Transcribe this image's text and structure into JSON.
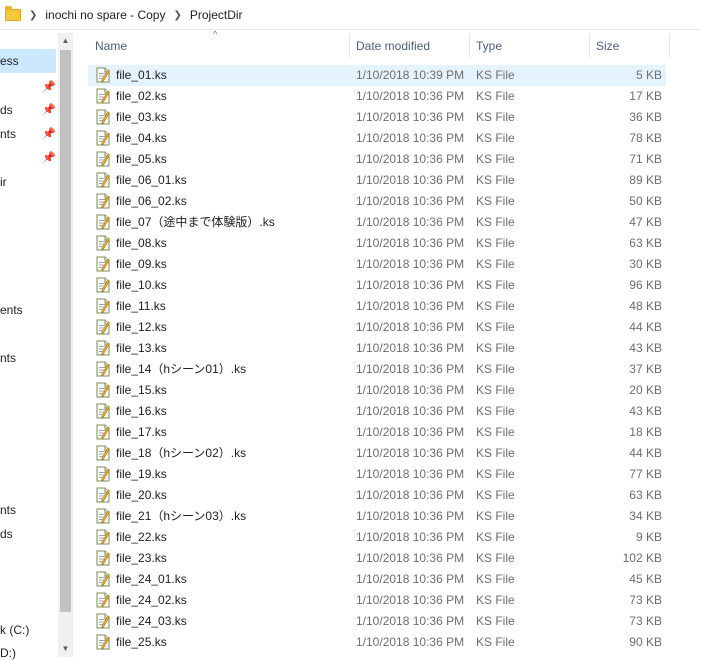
{
  "breadcrumb": {
    "items": [
      "inochi no spare - Copy",
      "ProjectDir"
    ]
  },
  "nav": {
    "items": [
      "ess",
      "ds",
      "nts",
      "",
      "ir",
      "ents",
      "nts",
      "nts",
      "ds",
      "k (C:)",
      "D:)"
    ]
  },
  "columns": {
    "name": "Name",
    "date": "Date modified",
    "type": "Type",
    "size": "Size"
  },
  "files": [
    {
      "name": "file_01.ks",
      "date": "1/10/2018 10:39 PM",
      "type": "KS File",
      "size": "5 KB"
    },
    {
      "name": "file_02.ks",
      "date": "1/10/2018 10:36 PM",
      "type": "KS File",
      "size": "17 KB"
    },
    {
      "name": "file_03.ks",
      "date": "1/10/2018 10:36 PM",
      "type": "KS File",
      "size": "36 KB"
    },
    {
      "name": "file_04.ks",
      "date": "1/10/2018 10:36 PM",
      "type": "KS File",
      "size": "78 KB"
    },
    {
      "name": "file_05.ks",
      "date": "1/10/2018 10:36 PM",
      "type": "KS File",
      "size": "71 KB"
    },
    {
      "name": "file_06_01.ks",
      "date": "1/10/2018 10:36 PM",
      "type": "KS File",
      "size": "89 KB"
    },
    {
      "name": "file_06_02.ks",
      "date": "1/10/2018 10:36 PM",
      "type": "KS File",
      "size": "50 KB"
    },
    {
      "name": "file_07（途中まで体験版）.ks",
      "date": "1/10/2018 10:36 PM",
      "type": "KS File",
      "size": "47 KB"
    },
    {
      "name": "file_08.ks",
      "date": "1/10/2018 10:36 PM",
      "type": "KS File",
      "size": "63 KB"
    },
    {
      "name": "file_09.ks",
      "date": "1/10/2018 10:36 PM",
      "type": "KS File",
      "size": "30 KB"
    },
    {
      "name": "file_10.ks",
      "date": "1/10/2018 10:36 PM",
      "type": "KS File",
      "size": "96 KB"
    },
    {
      "name": "file_11.ks",
      "date": "1/10/2018 10:36 PM",
      "type": "KS File",
      "size": "48 KB"
    },
    {
      "name": "file_12.ks",
      "date": "1/10/2018 10:36 PM",
      "type": "KS File",
      "size": "44 KB"
    },
    {
      "name": "file_13.ks",
      "date": "1/10/2018 10:36 PM",
      "type": "KS File",
      "size": "43 KB"
    },
    {
      "name": "file_14（hシーン01）.ks",
      "date": "1/10/2018 10:36 PM",
      "type": "KS File",
      "size": "37 KB"
    },
    {
      "name": "file_15.ks",
      "date": "1/10/2018 10:36 PM",
      "type": "KS File",
      "size": "20 KB"
    },
    {
      "name": "file_16.ks",
      "date": "1/10/2018 10:36 PM",
      "type": "KS File",
      "size": "43 KB"
    },
    {
      "name": "file_17.ks",
      "date": "1/10/2018 10:36 PM",
      "type": "KS File",
      "size": "18 KB"
    },
    {
      "name": "file_18（hシーン02）.ks",
      "date": "1/10/2018 10:36 PM",
      "type": "KS File",
      "size": "44 KB"
    },
    {
      "name": "file_19.ks",
      "date": "1/10/2018 10:36 PM",
      "type": "KS File",
      "size": "77 KB"
    },
    {
      "name": "file_20.ks",
      "date": "1/10/2018 10:36 PM",
      "type": "KS File",
      "size": "63 KB"
    },
    {
      "name": "file_21（hシーン03）.ks",
      "date": "1/10/2018 10:36 PM",
      "type": "KS File",
      "size": "34 KB"
    },
    {
      "name": "file_22.ks",
      "date": "1/10/2018 10:36 PM",
      "type": "KS File",
      "size": "9 KB"
    },
    {
      "name": "file_23.ks",
      "date": "1/10/2018 10:36 PM",
      "type": "KS File",
      "size": "102 KB"
    },
    {
      "name": "file_24_01.ks",
      "date": "1/10/2018 10:36 PM",
      "type": "KS File",
      "size": "45 KB"
    },
    {
      "name": "file_24_02.ks",
      "date": "1/10/2018 10:36 PM",
      "type": "KS File",
      "size": "73 KB"
    },
    {
      "name": "file_24_03.ks",
      "date": "1/10/2018 10:36 PM",
      "type": "KS File",
      "size": "73 KB"
    },
    {
      "name": "file_25.ks",
      "date": "1/10/2018 10:36 PM",
      "type": "KS File",
      "size": "90 KB"
    }
  ],
  "selected_index": 0,
  "icons": {
    "breadcrumb_folder": "folder-icon",
    "breadcrumb_separator": "chevron-right-icon",
    "file": "ks-file-icon",
    "pin": "pin-icon",
    "sort": "sort-up-arrow-icon"
  },
  "colors": {
    "selected_row": "#e5f3ff",
    "selected_nav": "#cce8ff",
    "header_text": "#4c607a",
    "muted_text": "#6d6d6d"
  }
}
